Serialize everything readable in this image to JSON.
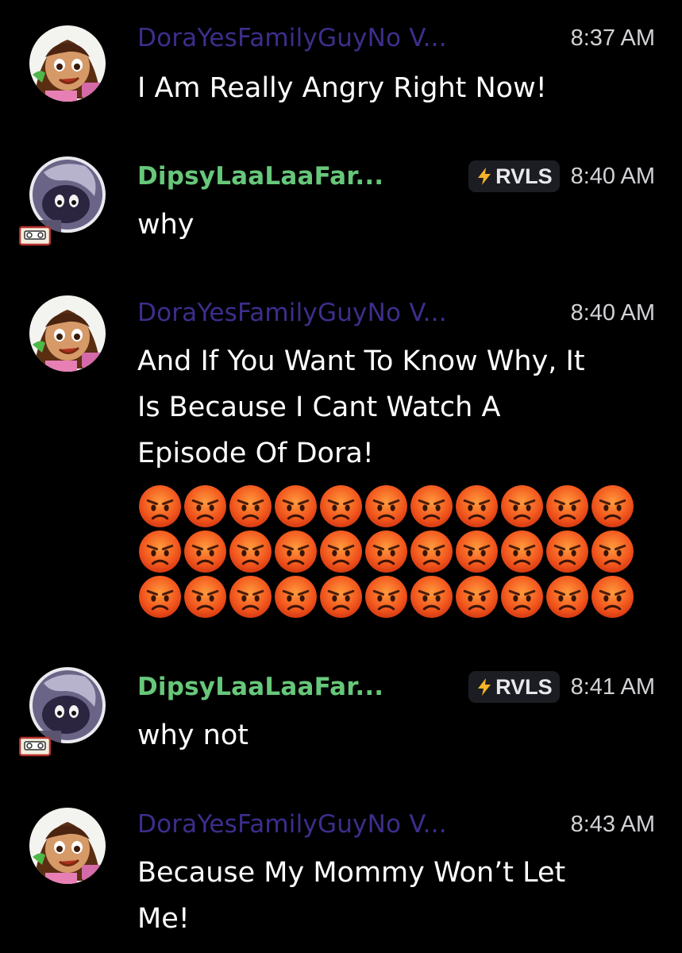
{
  "theme": {
    "background": "#000000",
    "dora_name_color": "#3d2e8c",
    "dipsy_name_color": "#67c77a",
    "text_color": "#ffffff",
    "time_color": "#d2d2d6",
    "tag_bg": "#1c1d22"
  },
  "messages": [
    {
      "author": "DoraYesFamilyGuyNo V...",
      "avatar": "dora-avatar",
      "time": "8:37 AM",
      "lines": [
        "I Am Really Angry Right Now!"
      ]
    },
    {
      "author": "DipsyLaaLaaFar...",
      "avatar": "dipsy-avatar",
      "tag": "RVLS",
      "tag_icon": "lightning-icon",
      "time": "8:40 AM",
      "lines": [
        "why"
      ]
    },
    {
      "author": "DoraYesFamilyGuyNo V...",
      "avatar": "dora-avatar",
      "time": "8:40 AM",
      "lines": [
        "And If You Want To Know Why, It",
        "Is Because I Cant Watch A",
        "Episode Of Dora!"
      ],
      "emoji": {
        "name": "angry-face-emoji",
        "glyph": "😡",
        "rows": 3,
        "per_row": 11
      }
    },
    {
      "author": "DipsyLaaLaaFar...",
      "avatar": "dipsy-avatar",
      "tag": "RVLS",
      "tag_icon": "lightning-icon",
      "time": "8:41 AM",
      "lines": [
        "why not"
      ]
    },
    {
      "author": "DoraYesFamilyGuyNo V...",
      "avatar": "dora-avatar",
      "time": "8:43 AM",
      "lines": [
        "Because My Mommy Won’t Let",
        "Me!"
      ]
    }
  ]
}
